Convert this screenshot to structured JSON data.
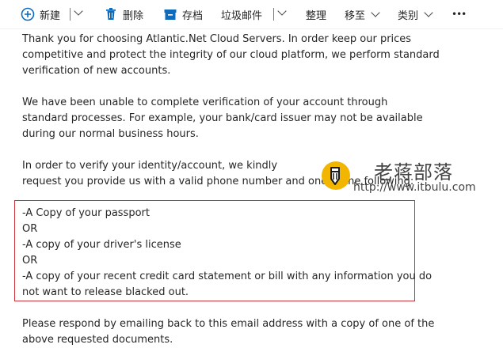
{
  "toolbar": {
    "new_label": "新建",
    "delete_label": "删除",
    "archive_label": "存档",
    "junk_label": "垃圾邮件",
    "sweep_label": "整理",
    "move_label": "移至",
    "category_label": "类别",
    "more_label": "•••"
  },
  "email": {
    "p1": [
      "Thank you for choosing Atlantic.Net Cloud Servers. In order keep our prices",
      "competitive and protect the integrity of our cloud platform, we perform standard",
      "verification of new accounts."
    ],
    "p2": [
      "We have been unable to complete verification of your account through",
      "standard processes. For example, your bank/card issuer may not be available",
      "during our normal business hours."
    ],
    "p3": [
      "In order to verify your identity/account, we kindly",
      "request you provide us with a valid phone number and one of the following:"
    ],
    "requirements": [
      "-A Copy of your passport",
      "OR",
      "-A copy of your driver's license",
      "OR",
      "-A copy of your recent credit card statement or bill with any information you do",
      "not want to release blacked out."
    ],
    "p4": [
      "Please respond by emailing back to this email address with a copy of one of the",
      "above requested documents."
    ]
  },
  "watermark": {
    "title": "老蒋部落",
    "url": "http://www.itbulu.com"
  },
  "colors": {
    "accent": "#0f6cbd",
    "highlight_border": "#c8333a",
    "watermark_badge": "#f2b600"
  }
}
